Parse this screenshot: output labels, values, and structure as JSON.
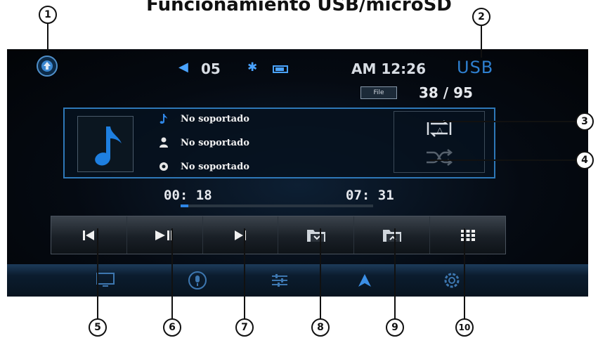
{
  "page": {
    "title": "Funcionamiento USB/microSD"
  },
  "status": {
    "volume": "05",
    "clock": "AM 12:26",
    "source": "USB",
    "file_label": "File",
    "file_count": "38 / 95"
  },
  "track": {
    "title": "No soportado",
    "artist": "No soportado",
    "album": "No soportado"
  },
  "playback": {
    "elapsed": "00: 18",
    "total": "07: 31",
    "progress_fraction": 0.04
  },
  "icons": {
    "home": "up-arrow-icon",
    "volume": "speaker-icon",
    "bluetooth": "bluetooth-icon",
    "battery": "battery-icon",
    "album_art": "music-note-icon",
    "repeat": "repeat-icon",
    "shuffle": "shuffle-icon",
    "controls": [
      "previous-icon",
      "play-pause-icon",
      "next-icon",
      "folder-down-icon",
      "folder-up-icon",
      "grid-icon"
    ],
    "nav": [
      "screen-icon",
      "microphone-icon",
      "equalizer-icon",
      "navigation-icon",
      "settings-icon"
    ]
  },
  "callouts": [
    "1",
    "2",
    "3",
    "4",
    "5",
    "6",
    "7",
    "8",
    "9",
    "10"
  ],
  "colors": {
    "accent": "#2f86e6",
    "background": "#050a12"
  }
}
